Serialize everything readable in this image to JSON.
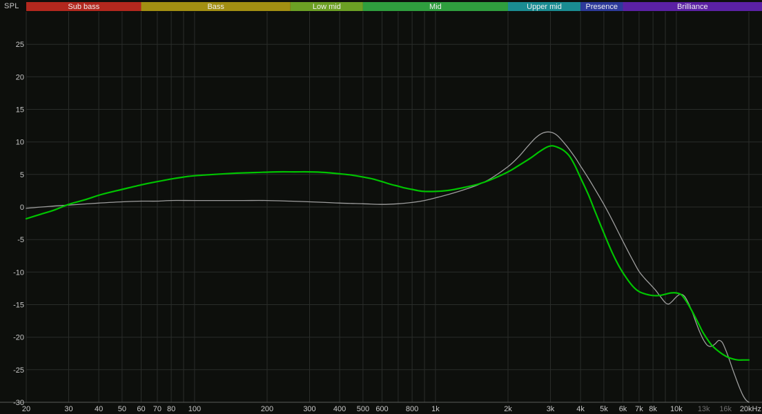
{
  "chart": {
    "spl_label": "SPL",
    "bg": "#0d0f0c",
    "grid_color": "#2a2d2a",
    "axis_color": "#5a5d5a",
    "text_color": "#c9c9c9",
    "muted_text_color": "#6f6f6f",
    "band_text_color": "#f0f0f0",
    "bands": [
      {
        "label": "Sub bass",
        "from": 20,
        "to": 60,
        "color": "#b2281e"
      },
      {
        "label": "Bass",
        "from": 60,
        "to": 250,
        "color": "#a28f12"
      },
      {
        "label": "Low mid",
        "from": 250,
        "to": 500,
        "color": "#6ca024"
      },
      {
        "label": "Mid",
        "from": 500,
        "to": 2000,
        "color": "#2f9e3e"
      },
      {
        "label": "Upper mid",
        "from": 2000,
        "to": 4000,
        "color": "#1a8c92"
      },
      {
        "label": "Presence",
        "from": 4000,
        "to": 6000,
        "color": "#2d3a9a"
      },
      {
        "label": "Brilliance",
        "from": 6000,
        "to": 20000,
        "color": "#5b21a4"
      }
    ],
    "grid_freqs": [
      20,
      30,
      40,
      50,
      60,
      70,
      80,
      90,
      100,
      200,
      300,
      400,
      500,
      600,
      700,
      800,
      900,
      1000,
      2000,
      3000,
      4000,
      5000,
      6000,
      7000,
      8000,
      9000,
      10000,
      20000
    ],
    "y_ticks": [
      25,
      20,
      15,
      10,
      5,
      0,
      -5,
      -10,
      -15,
      -20,
      -25,
      -30
    ],
    "x_ticks": [
      {
        "f": 20,
        "label": "20"
      },
      {
        "f": 30,
        "label": "30"
      },
      {
        "f": 40,
        "label": "40"
      },
      {
        "f": 50,
        "label": "50"
      },
      {
        "f": 60,
        "label": "60"
      },
      {
        "f": 70,
        "label": "70"
      },
      {
        "f": 80,
        "label": "80"
      },
      {
        "f": 100,
        "label": "100"
      },
      {
        "f": 200,
        "label": "200"
      },
      {
        "f": 300,
        "label": "300"
      },
      {
        "f": 400,
        "label": "400"
      },
      {
        "f": 500,
        "label": "500"
      },
      {
        "f": 600,
        "label": "600"
      },
      {
        "f": 800,
        "label": "800"
      },
      {
        "f": 1000,
        "label": "1k"
      },
      {
        "f": 2000,
        "label": "2k"
      },
      {
        "f": 3000,
        "label": "3k"
      },
      {
        "f": 4000,
        "label": "4k"
      },
      {
        "f": 5000,
        "label": "5k"
      },
      {
        "f": 6000,
        "label": "6k"
      },
      {
        "f": 7000,
        "label": "7k"
      },
      {
        "f": 8000,
        "label": "8k"
      },
      {
        "f": 10000,
        "label": "10k"
      },
      {
        "f": 13000,
        "label": "13k",
        "muted": true
      },
      {
        "f": 16000,
        "label": "16k",
        "muted": true
      },
      {
        "f": 20000,
        "label": "20kHz",
        "anchor": "end"
      }
    ]
  },
  "chart_data": {
    "type": "line",
    "title": "",
    "ylabel": "SPL",
    "x_scale": "log",
    "xlim": [
      20,
      20000
    ],
    "ylim": [
      -30,
      30
    ],
    "grid": true,
    "legend": false,
    "series": [
      {
        "name": "gray_trace",
        "color": "#9e9e9e",
        "width": 1.3,
        "points": [
          [
            20,
            -0.2
          ],
          [
            25,
            0.1
          ],
          [
            30,
            0.3
          ],
          [
            40,
            0.6
          ],
          [
            50,
            0.8
          ],
          [
            60,
            0.9
          ],
          [
            70,
            0.9
          ],
          [
            80,
            1.0
          ],
          [
            100,
            1.0
          ],
          [
            130,
            1.0
          ],
          [
            160,
            1.0
          ],
          [
            200,
            1.0
          ],
          [
            250,
            0.9
          ],
          [
            300,
            0.8
          ],
          [
            350,
            0.7
          ],
          [
            400,
            0.6
          ],
          [
            500,
            0.5
          ],
          [
            600,
            0.4
          ],
          [
            700,
            0.5
          ],
          [
            800,
            0.7
          ],
          [
            900,
            1.0
          ],
          [
            1000,
            1.4
          ],
          [
            1150,
            2.0
          ],
          [
            1300,
            2.6
          ],
          [
            1500,
            3.4
          ],
          [
            1700,
            4.4
          ],
          [
            2000,
            6.2
          ],
          [
            2200,
            7.6
          ],
          [
            2400,
            9.2
          ],
          [
            2600,
            10.6
          ],
          [
            2800,
            11.4
          ],
          [
            3000,
            11.5
          ],
          [
            3200,
            11.0
          ],
          [
            3500,
            9.4
          ],
          [
            3800,
            7.6
          ],
          [
            4000,
            6.3
          ],
          [
            4300,
            4.5
          ],
          [
            4600,
            2.7
          ],
          [
            5000,
            0.4
          ],
          [
            5400,
            -1.9
          ],
          [
            5800,
            -4.2
          ],
          [
            6200,
            -6.3
          ],
          [
            6600,
            -8.2
          ],
          [
            7000,
            -9.9
          ],
          [
            7400,
            -11.0
          ],
          [
            7800,
            -11.9
          ],
          [
            8200,
            -12.8
          ],
          [
            8600,
            -13.8
          ],
          [
            9000,
            -14.7
          ],
          [
            9300,
            -14.9
          ],
          [
            9600,
            -14.5
          ],
          [
            10000,
            -13.8
          ],
          [
            10400,
            -13.4
          ],
          [
            10800,
            -13.7
          ],
          [
            11200,
            -14.7
          ],
          [
            11600,
            -16.0
          ],
          [
            12000,
            -17.5
          ],
          [
            12500,
            -19.2
          ],
          [
            13000,
            -20.5
          ],
          [
            13500,
            -21.3
          ],
          [
            14000,
            -21.4
          ],
          [
            14500,
            -21.0
          ],
          [
            15000,
            -20.5
          ],
          [
            15500,
            -20.8
          ],
          [
            16000,
            -21.9
          ],
          [
            16500,
            -23.2
          ],
          [
            17000,
            -24.6
          ],
          [
            17500,
            -25.9
          ],
          [
            18000,
            -27.1
          ],
          [
            18500,
            -28.2
          ],
          [
            19000,
            -29.1
          ],
          [
            19500,
            -29.7
          ],
          [
            20000,
            -30.0
          ]
        ]
      },
      {
        "name": "green_trace",
        "color": "#00c400",
        "width": 2.2,
        "points": [
          [
            20,
            -1.8
          ],
          [
            23,
            -1.1
          ],
          [
            26,
            -0.5
          ],
          [
            30,
            0.4
          ],
          [
            35,
            1.1
          ],
          [
            40,
            1.8
          ],
          [
            45,
            2.3
          ],
          [
            50,
            2.7
          ],
          [
            60,
            3.4
          ],
          [
            70,
            3.9
          ],
          [
            80,
            4.3
          ],
          [
            90,
            4.6
          ],
          [
            100,
            4.8
          ],
          [
            120,
            5.0
          ],
          [
            150,
            5.2
          ],
          [
            180,
            5.3
          ],
          [
            220,
            5.4
          ],
          [
            260,
            5.4
          ],
          [
            300,
            5.4
          ],
          [
            350,
            5.3
          ],
          [
            400,
            5.1
          ],
          [
            450,
            4.9
          ],
          [
            500,
            4.6
          ],
          [
            550,
            4.3
          ],
          [
            600,
            3.9
          ],
          [
            650,
            3.5
          ],
          [
            700,
            3.2
          ],
          [
            750,
            2.9
          ],
          [
            800,
            2.7
          ],
          [
            850,
            2.5
          ],
          [
            900,
            2.4
          ],
          [
            1000,
            2.4
          ],
          [
            1100,
            2.5
          ],
          [
            1200,
            2.7
          ],
          [
            1350,
            3.1
          ],
          [
            1500,
            3.5
          ],
          [
            1700,
            4.2
          ],
          [
            2000,
            5.4
          ],
          [
            2200,
            6.3
          ],
          [
            2500,
            7.6
          ],
          [
            2700,
            8.5
          ],
          [
            2900,
            9.2
          ],
          [
            3050,
            9.4
          ],
          [
            3200,
            9.2
          ],
          [
            3400,
            8.7
          ],
          [
            3600,
            7.8
          ],
          [
            3800,
            6.3
          ],
          [
            4000,
            4.5
          ],
          [
            4300,
            2.0
          ],
          [
            4600,
            -0.7
          ],
          [
            5000,
            -4.0
          ],
          [
            5400,
            -6.9
          ],
          [
            5800,
            -9.2
          ],
          [
            6200,
            -10.9
          ],
          [
            6600,
            -12.2
          ],
          [
            7000,
            -13.0
          ],
          [
            7500,
            -13.4
          ],
          [
            8000,
            -13.6
          ],
          [
            8500,
            -13.6
          ],
          [
            9000,
            -13.4
          ],
          [
            9500,
            -13.2
          ],
          [
            10000,
            -13.2
          ],
          [
            10500,
            -13.5
          ],
          [
            11000,
            -14.5
          ],
          [
            11500,
            -15.7
          ],
          [
            12000,
            -17.0
          ],
          [
            12500,
            -18.3
          ],
          [
            13000,
            -19.5
          ],
          [
            14000,
            -21.2
          ],
          [
            15000,
            -22.2
          ],
          [
            16000,
            -22.9
          ],
          [
            17000,
            -23.3
          ],
          [
            18000,
            -23.5
          ],
          [
            19000,
            -23.5
          ],
          [
            20000,
            -23.5
          ]
        ]
      }
    ]
  }
}
